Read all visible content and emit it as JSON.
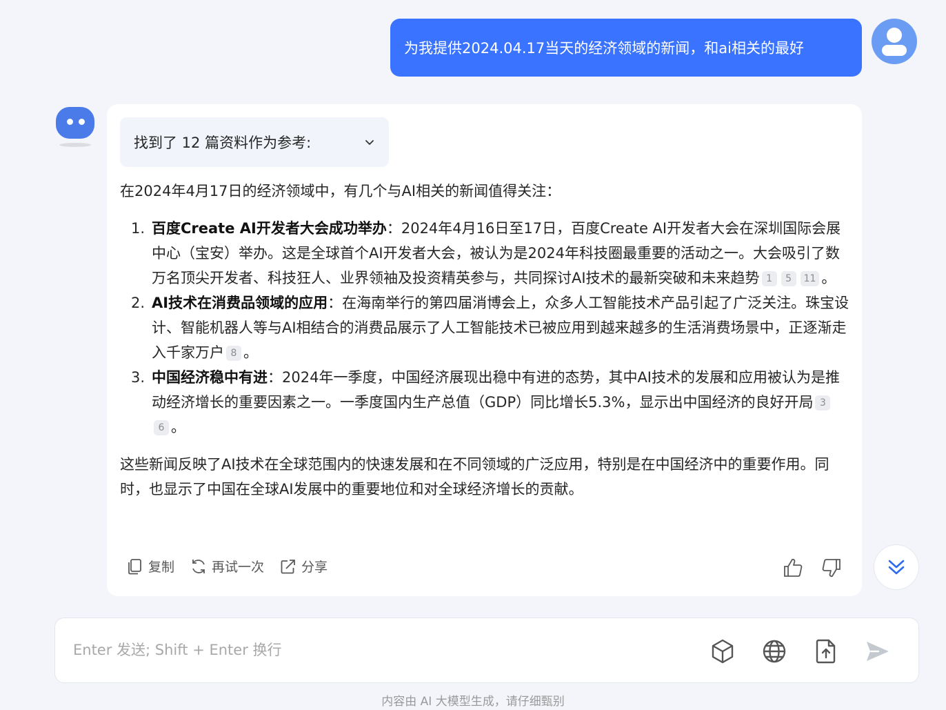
{
  "user": {
    "message": "为我提供2024.04.17当天的经济领域的新闻，和ai相关的最好"
  },
  "bot": {
    "references_label": "找到了 12 篇资料作为参考:",
    "intro": "在2024年4月17日的经济领域中，有几个与AI相关的新闻值得关注：",
    "items": [
      {
        "num": "1.",
        "title": "百度Create AI开发者大会成功举办",
        "text": "：2024年4月16日至17日，百度Create AI开发者大会在深圳国际会展中心（宝安）举办。这是全球首个AI开发者大会，被认为是2024年科技圈最重要的活动之一。大会吸引了数万名顶尖开发者、科技狂人、业界领袖及投资精英参与，共同探讨AI技术的最新突破和未来趋势",
        "cites": [
          "1",
          "5",
          "11"
        ]
      },
      {
        "num": "2.",
        "title": "AI技术在消费品领域的应用",
        "text": "：在海南举行的第四届消博会上，众多人工智能技术产品引起了广泛关注。珠宝设计、智能机器人等与AI相结合的消费品展示了人工智能技术已被应用到越来越多的生活消费场景中，正逐渐走入千家万户",
        "cites": [
          "8"
        ]
      },
      {
        "num": "3.",
        "title": "中国经济稳中有进",
        "text": "：2024年一季度，中国经济展现出稳中有进的态势，其中AI技术的发展和应用被认为是推动经济增长的重要因素之一。一季度国内生产总值（GDP）同比增长5.3%，显示出中国经济的良好开局",
        "cites": [
          "3",
          "6"
        ]
      }
    ],
    "item_end": "。",
    "conclusion": "这些新闻反映了AI技术在全球范围内的快速发展和在不同领域的广泛应用，特别是在中国经济中的重要作用。同时，也显示了中国在全球AI发展中的重要地位和对全球经济增长的贡献。",
    "actions": {
      "copy": "复制",
      "retry": "再试一次",
      "share": "分享"
    }
  },
  "input": {
    "placeholder": "Enter 发送; Shift + Enter 换行"
  },
  "footer": "内容由 AI 大模型生成，请仔细甄别",
  "colors": {
    "accent": "#3a73ff",
    "background": "#f3f5fa"
  },
  "icons": [
    "user-avatar-icon",
    "bot-avatar-icon",
    "chevron-down-icon",
    "copy-icon",
    "retry-icon",
    "share-icon",
    "thumbs-up-icon",
    "thumbs-down-icon",
    "double-chevron-down-icon",
    "cube-icon",
    "globe-icon",
    "upload-file-icon",
    "send-icon"
  ]
}
